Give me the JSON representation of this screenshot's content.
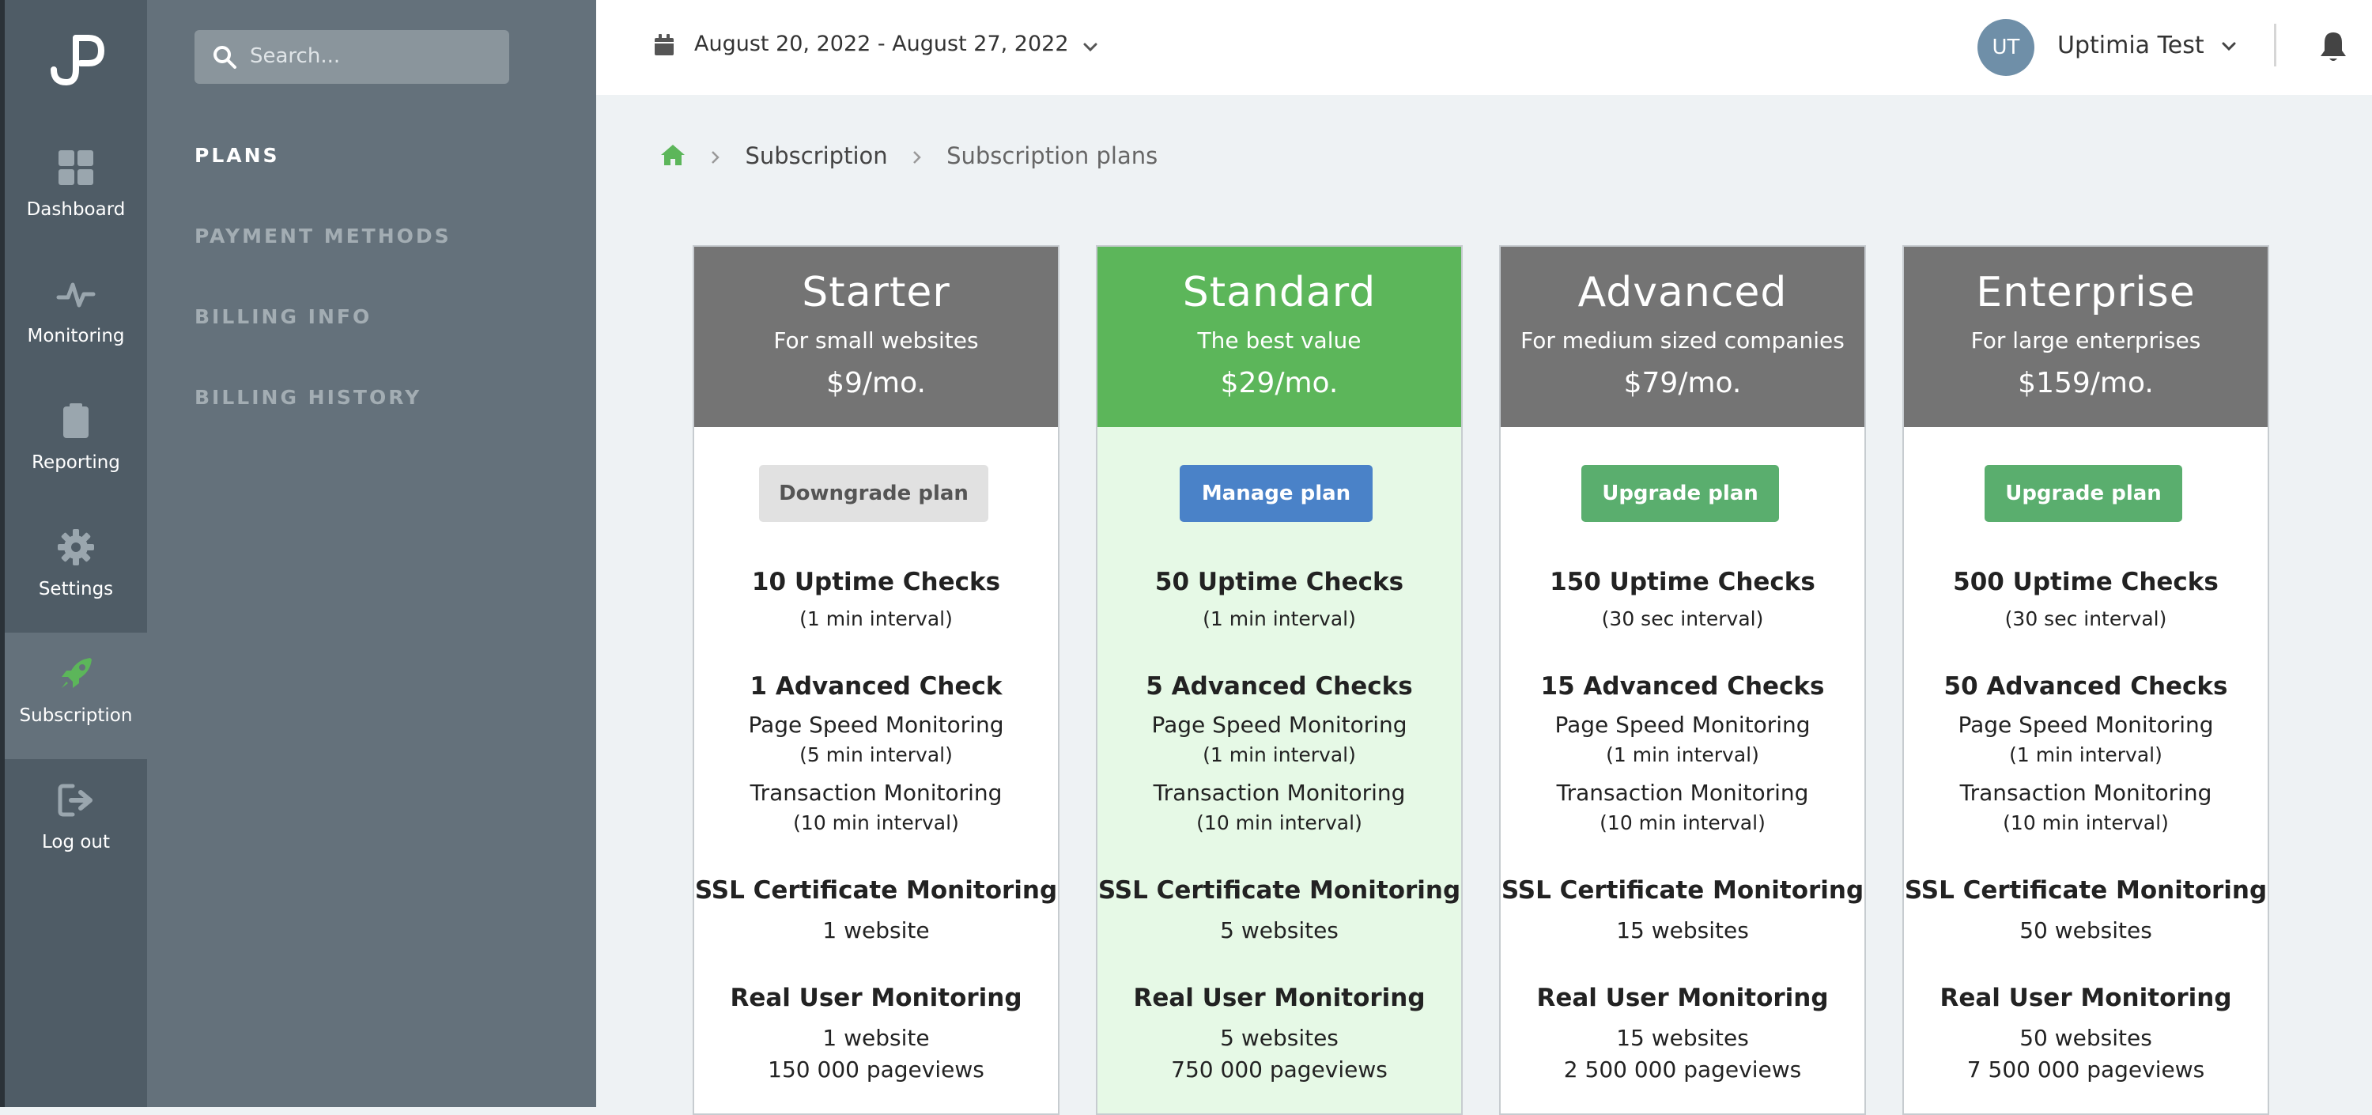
{
  "sidebar": {
    "logo_text": "JP",
    "items": [
      {
        "label": "Dashboard",
        "icon": "dashboard-icon"
      },
      {
        "label": "Monitoring",
        "icon": "pulse-icon"
      },
      {
        "label": "Reporting",
        "icon": "clipboard-icon"
      },
      {
        "label": "Settings",
        "icon": "gear-icon"
      },
      {
        "label": "Subscription",
        "icon": "rocket-icon"
      },
      {
        "label": "Log out",
        "icon": "logout-icon"
      }
    ]
  },
  "subnav": {
    "search_placeholder": "Search...",
    "items": [
      {
        "label": "PLANS"
      },
      {
        "label": "PAYMENT METHODS"
      },
      {
        "label": "BILLING INFO"
      },
      {
        "label": "BILLING HISTORY"
      }
    ]
  },
  "topbar": {
    "date_range": "August 20, 2022 - August 27, 2022",
    "avatar_initials": "UT",
    "user_name": "Uptimia Test"
  },
  "breadcrumb": {
    "section": "Subscription",
    "current": "Subscription plans"
  },
  "colors": {
    "accent_green": "#5cb65a",
    "button_green": "#5aae6e",
    "button_blue": "#4a82c8",
    "header_gray": "#747474"
  },
  "plans": [
    {
      "name": "Starter",
      "tagline": "For small websites",
      "price": "$9/mo.",
      "button": "Downgrade plan",
      "uptime": "10 Uptime Checks",
      "uptime_interval": "(1 min interval)",
      "advanced": "1 Advanced Check",
      "speed": "Page Speed Monitoring",
      "speed_interval": "(5 min interval)",
      "transaction": "Transaction Monitoring",
      "transaction_interval": "(10 min interval)",
      "ssl": "SSL Certificate Monitoring",
      "ssl_count": "1 website",
      "rum": "Real User Monitoring",
      "rum_sites": "1 website",
      "rum_views": "150 000 pageviews"
    },
    {
      "name": "Standard",
      "tagline": "The best value",
      "price": "$29/mo.",
      "button": "Manage plan",
      "uptime": "50 Uptime Checks",
      "uptime_interval": "(1 min interval)",
      "advanced": "5 Advanced Checks",
      "speed": "Page Speed Monitoring",
      "speed_interval": "(1 min interval)",
      "transaction": "Transaction Monitoring",
      "transaction_interval": "(10 min interval)",
      "ssl": "SSL Certificate Monitoring",
      "ssl_count": "5 websites",
      "rum": "Real User Monitoring",
      "rum_sites": "5 websites",
      "rum_views": "750 000 pageviews"
    },
    {
      "name": "Advanced",
      "tagline": "For medium sized companies",
      "price": "$79/mo.",
      "button": "Upgrade plan",
      "uptime": "150 Uptime Checks",
      "uptime_interval": "(30 sec interval)",
      "advanced": "15 Advanced Checks",
      "speed": "Page Speed Monitoring",
      "speed_interval": "(1 min interval)",
      "transaction": "Transaction Monitoring",
      "transaction_interval": "(10 min interval)",
      "ssl": "SSL Certificate Monitoring",
      "ssl_count": "15 websites",
      "rum": "Real User Monitoring",
      "rum_sites": "15 websites",
      "rum_views": "2 500 000 pageviews"
    },
    {
      "name": "Enterprise",
      "tagline": "For large enterprises",
      "price": "$159/mo.",
      "button": "Upgrade plan",
      "uptime": "500 Uptime Checks",
      "uptime_interval": "(30 sec interval)",
      "advanced": "50 Advanced Checks",
      "speed": "Page Speed Monitoring",
      "speed_interval": "(1 min interval)",
      "transaction": "Transaction Monitoring",
      "transaction_interval": "(10 min interval)",
      "ssl": "SSL Certificate Monitoring",
      "ssl_count": "50 websites",
      "rum": "Real User Monitoring",
      "rum_sites": "50 websites",
      "rum_views": "7 500 000 pageviews"
    }
  ]
}
